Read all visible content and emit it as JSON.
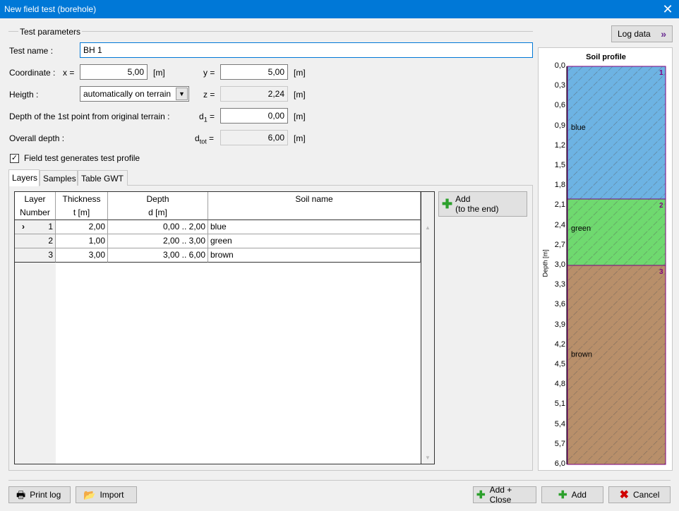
{
  "window": {
    "title": "New field test (borehole)"
  },
  "params": {
    "group_title": "Test parameters",
    "test_name_label": "Test name :",
    "test_name": "BH 1",
    "coordinate_label": "Coordinate :",
    "x_label": "x =",
    "x_value": "5,00",
    "y_label": "y =",
    "y_value": "5,00",
    "unit_m": "[m]",
    "height_label": "Heigth :",
    "height_mode": "automatically on terrain",
    "z_label": "z =",
    "z_value": "2,24",
    "depth1_label": "Depth of the 1st point from original terrain :",
    "d1_label_main": "d",
    "d1_label_sub": "1",
    "d1_label_eq": " =",
    "d1_value": "0,00",
    "overall_label": "Overall depth :",
    "dtot_label_main": "d",
    "dtot_label_sub": "tot",
    "dtot_label_eq": " =",
    "dtot_value": "6,00",
    "generates_label": "Field test generates test profile"
  },
  "tabs": [
    "Layers",
    "Samples",
    "Table GWT"
  ],
  "table": {
    "headers": [
      {
        "line1": "Layer",
        "line2": "Number"
      },
      {
        "line1": "Thickness",
        "line2": "t [m]"
      },
      {
        "line1": "Depth",
        "line2": "d [m]"
      },
      {
        "line1": "Soil name",
        "line2": ""
      }
    ],
    "rows": [
      {
        "number": "1",
        "thickness": "2,00",
        "depth": "0,00 .. 2,00",
        "soil": "blue"
      },
      {
        "number": "2",
        "thickness": "1,00",
        "depth": "2,00 .. 3,00",
        "soil": "green"
      },
      {
        "number": "3",
        "thickness": "3,00",
        "depth": "3,00 .. 6,00",
        "soil": "brown"
      }
    ],
    "current_row_marker": "›"
  },
  "add_end": {
    "line1": "Add",
    "line2": "(to the end)"
  },
  "log_data": "Log data",
  "profile": {
    "title": "Soil profile",
    "axis_label": "Depth [m]",
    "ticks": [
      "0,0",
      "0,3",
      "0,6",
      "0,9",
      "1,2",
      "1,5",
      "1,8",
      "2,1",
      "2,4",
      "2,7",
      "3,0",
      "3,3",
      "3,6",
      "3,9",
      "4,2",
      "4,5",
      "4,8",
      "5,1",
      "5,4",
      "5,7",
      "6,0"
    ],
    "max_depth": 6.0,
    "layers": [
      {
        "from": 0.0,
        "to": 2.0,
        "name": "blue",
        "index": "1",
        "color": "#6db3e3"
      },
      {
        "from": 2.0,
        "to": 3.0,
        "name": "green",
        "index": "2",
        "color": "#6fd96f"
      },
      {
        "from": 3.0,
        "to": 6.0,
        "name": "brown",
        "index": "3",
        "color": "#b88f6a"
      }
    ]
  },
  "footer": {
    "print_log": "Print log",
    "import": "Import",
    "add_close": "Add + Close",
    "add": "Add",
    "cancel": "Cancel"
  }
}
